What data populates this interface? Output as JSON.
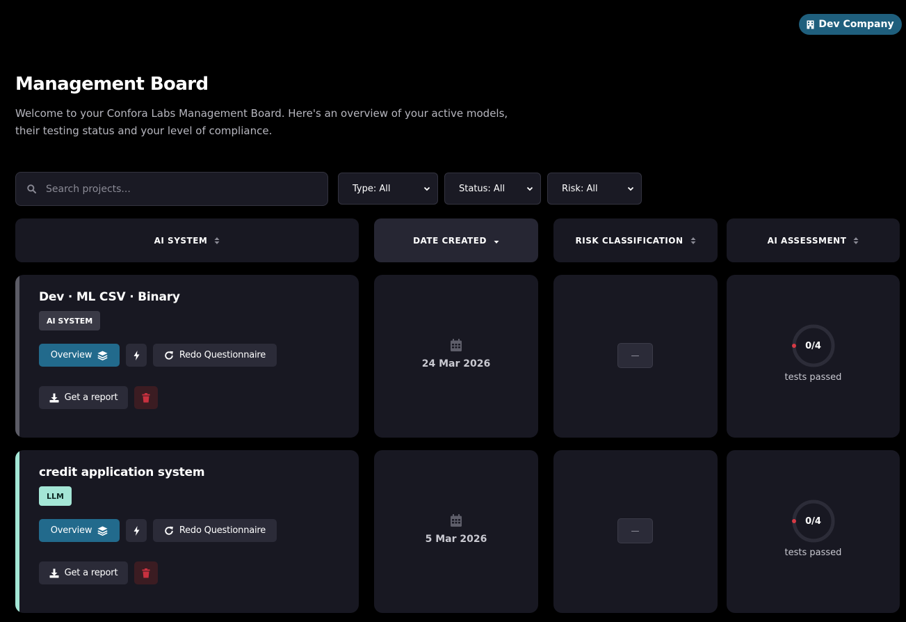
{
  "header": {
    "company_label": "Dev Company",
    "title": "Management Board",
    "subtitle": "Welcome to your Confora Labs Management Board. Here's an overview of your active models, their testing status and your level of compliance."
  },
  "search": {
    "placeholder": "Search projects...",
    "value": ""
  },
  "filters": {
    "type_label": "Type: All",
    "status_label": "Status: All",
    "risk_label": "Risk: All"
  },
  "columns": {
    "ai_system": "AI SYSTEM",
    "date_created": "DATE CREATED",
    "risk_classification": "RISK CLASSIFICATION",
    "ai_assessment": "AI ASSESSMENT",
    "sorted_by": "date_created",
    "sort_direction": "descending"
  },
  "actions": {
    "overview": "Overview",
    "redo": "Redo Questionnaire",
    "report": "Get a report"
  },
  "rows": [
    {
      "name": "Dev · ML CSV · Binary",
      "tag": "AI SYSTEM",
      "accent_color": "#5c5c66",
      "tag_bg": "#3a3a46",
      "tag_color": "#ffffff",
      "date": "24 Mar 2026",
      "risk": "—",
      "tests_score": "0/4",
      "tests_passed": 0,
      "tests_total": 4,
      "tests_label": "tests passed"
    },
    {
      "name": "credit application system",
      "tag": "LLM",
      "accent_color": "#a4e6d6",
      "tag_bg": "#a4e6d6",
      "tag_color": "#0f2a25",
      "date": "5 Mar 2026",
      "risk": "—",
      "tests_score": "0/4",
      "tests_passed": 0,
      "tests_total": 4,
      "tests_label": "tests passed"
    }
  ],
  "colors": {
    "primary": "#226a8c",
    "danger_icon": "#c8313f",
    "ring_track": "#2c2c38",
    "ring_dot": "#d63a45"
  }
}
